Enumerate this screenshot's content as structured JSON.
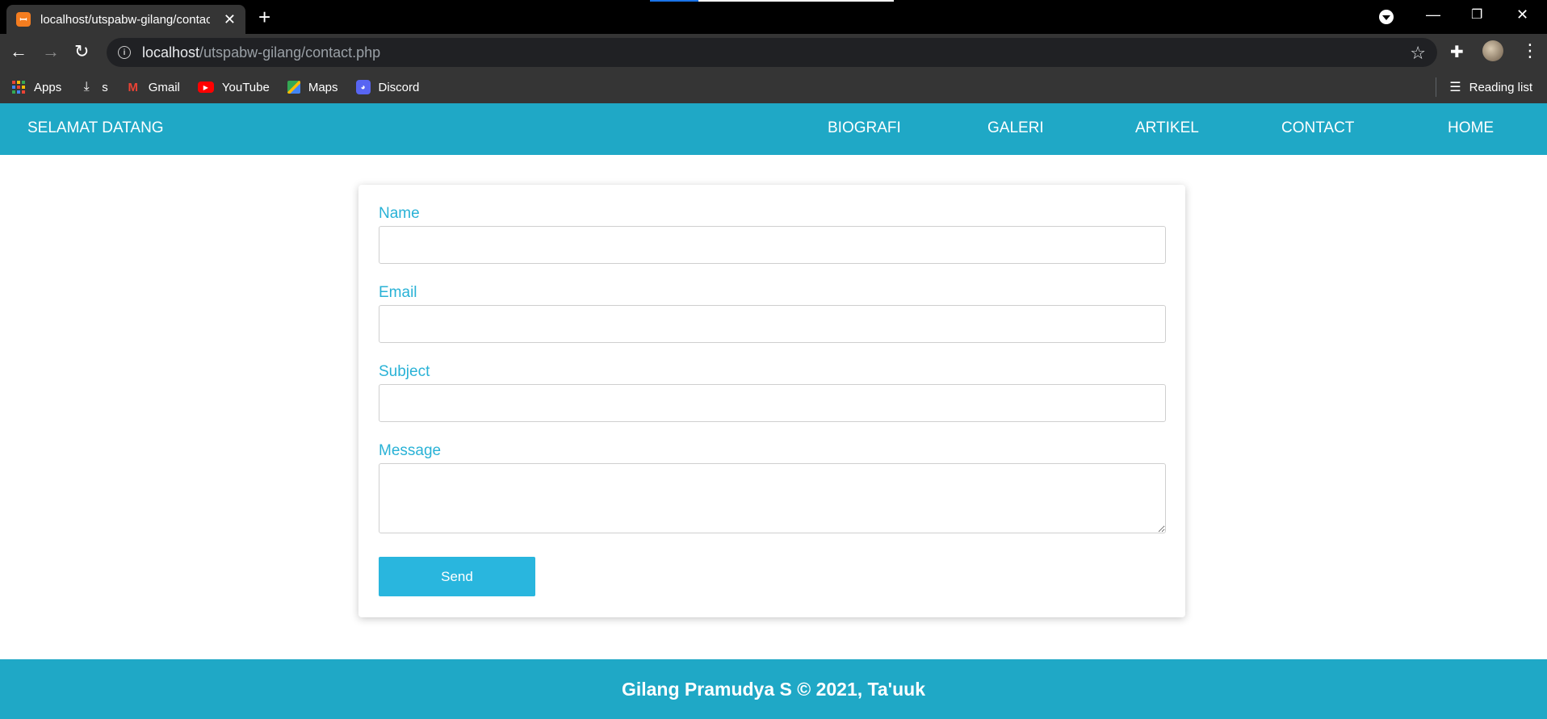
{
  "browser": {
    "tab_title": "localhost/utspabw-gilang/contact.php",
    "favicon_text": "ꟷ",
    "url_host": "localhost",
    "url_path": "/utspabw-gilang/contact.php",
    "bookmarks": [
      {
        "label": "Apps",
        "icon": "apps-grid-icon"
      },
      {
        "label": "s",
        "icon": "download-icon"
      },
      {
        "label": "Gmail",
        "icon": "gmail-icon"
      },
      {
        "label": "YouTube",
        "icon": "youtube-icon"
      },
      {
        "label": "Maps",
        "icon": "maps-icon"
      },
      {
        "label": "Discord",
        "icon": "discord-icon"
      }
    ],
    "reading_list": "Reading list"
  },
  "header": {
    "brand": "SELAMAT DATANG",
    "nav": [
      "BIOGRAFI",
      "GALERI",
      "ARTIKEL",
      "CONTACT",
      "HOME"
    ]
  },
  "form": {
    "name_label": "Name",
    "email_label": "Email",
    "subject_label": "Subject",
    "message_label": "Message",
    "name_value": "",
    "email_value": "",
    "subject_value": "",
    "message_value": "",
    "send_label": "Send"
  },
  "footer": {
    "text": "Gilang Pramudya S © 2021, Ta'uuk"
  },
  "colors": {
    "header_bg": "#1fa8c6",
    "label": "#29b2d6",
    "button": "#29b6de"
  }
}
